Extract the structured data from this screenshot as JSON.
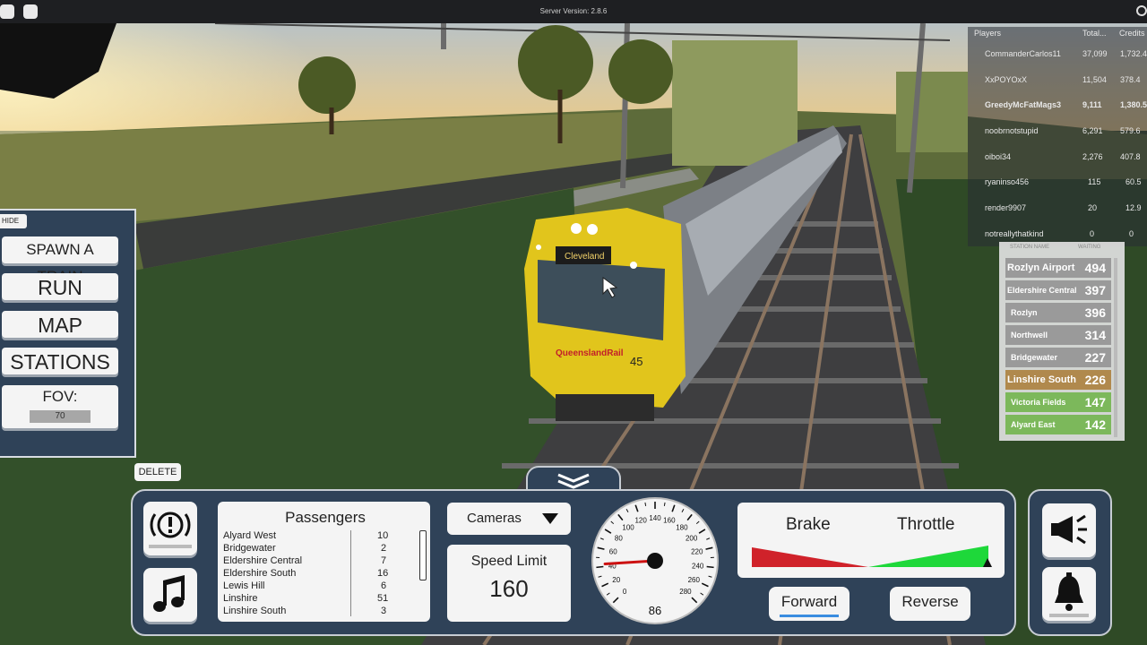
{
  "topbar": {
    "server_version": "Server Version: 2.8.6"
  },
  "left_panel": {
    "hide_label": "HIDE",
    "spawn_label": "SPAWN A TRAIN",
    "run_label": "RUN",
    "map_label": "MAP",
    "stations_label": "STATIONS",
    "fov_label": "FOV:",
    "fov_value": "70",
    "delete_label": "DELETE"
  },
  "leaderboard": {
    "headers": [
      "Players",
      "Total...",
      "Credits"
    ],
    "rows": [
      {
        "name": "CommanderCarlos11",
        "total": "37,099",
        "credits": "1,732.4"
      },
      {
        "name": "XxPOYOxX",
        "total": "11,504",
        "credits": "378.4"
      },
      {
        "name": "GreedyMcFatMags3",
        "total": "9,111",
        "credits": "1,380.5"
      },
      {
        "name": "noobrnotstupid",
        "total": "6,291",
        "credits": "579.6"
      },
      {
        "name": "oiboi34",
        "total": "2,276",
        "credits": "407.8"
      },
      {
        "name": "ryaninso456",
        "total": "115",
        "credits": "60.5"
      },
      {
        "name": "render9907",
        "total": "20",
        "credits": "12.9"
      },
      {
        "name": "notreallythatkind",
        "total": "0",
        "credits": "0"
      }
    ]
  },
  "stations": {
    "headers": [
      "STATION NAME",
      "WAITING"
    ],
    "rows": [
      {
        "name": "Rozlyn Airport",
        "count": "494",
        "color": "#9a9a9a"
      },
      {
        "name": "Eldershire Central",
        "count": "397",
        "color": "#9a9a9a"
      },
      {
        "name": "Rozlyn",
        "count": "396",
        "color": "#9a9a9a"
      },
      {
        "name": "Northwell",
        "count": "314",
        "color": "#9a9a9a"
      },
      {
        "name": "Bridgewater",
        "count": "227",
        "color": "#9a9a9a"
      },
      {
        "name": "Linshire South",
        "count": "226",
        "color": "#b0894d"
      },
      {
        "name": "Victoria Fields",
        "count": "147",
        "color": "#7cb85b"
      },
      {
        "name": "Alyard East",
        "count": "142",
        "color": "#7cb85b"
      }
    ]
  },
  "passengers": {
    "title": "Passengers",
    "rows": [
      {
        "name": "Alyard West",
        "count": "10"
      },
      {
        "name": "Bridgewater",
        "count": "2"
      },
      {
        "name": "Eldershire Central",
        "count": "7"
      },
      {
        "name": "Eldershire South",
        "count": "16"
      },
      {
        "name": "Lewis Hill",
        "count": "6"
      },
      {
        "name": "Linshire",
        "count": "51"
      },
      {
        "name": "Linshire South",
        "count": "3"
      }
    ]
  },
  "controls": {
    "cameras_label": "Cameras",
    "speed_limit_label": "Speed Limit",
    "speed_limit_value": "160",
    "brake_label": "Brake",
    "throttle_label": "Throttle",
    "forward_label": "Forward",
    "reverse_label": "Reverse",
    "throttle_level": 0.95
  },
  "speedometer": {
    "ticks": [
      "0",
      "20",
      "40",
      "60",
      "80",
      "100",
      "120",
      "140",
      "160",
      "180",
      "200",
      "220",
      "240",
      "260",
      "280"
    ],
    "current_speed": "86",
    "max": 280
  },
  "train": {
    "destination": "Cleveland",
    "operator": "QueenslandRail",
    "number": "45"
  },
  "colors": {
    "hud_bg": "#2f4258",
    "brake_red": "#d0222a",
    "throttle_green": "#1ed83a",
    "needle": "#cc1111"
  }
}
